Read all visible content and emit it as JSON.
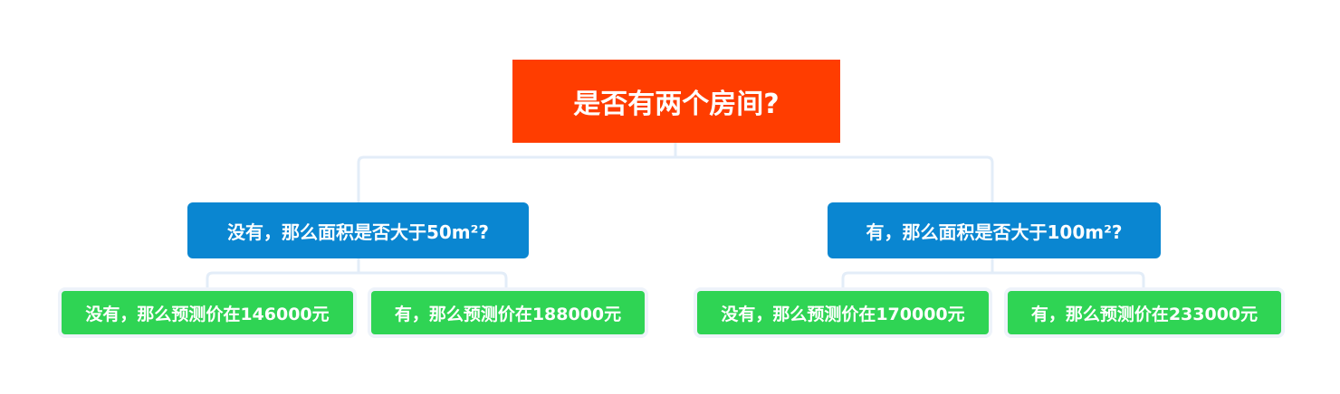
{
  "root": {
    "label": "是否有两个房间?"
  },
  "branches": [
    {
      "label": "没有，那么面积是否大于50m²?",
      "leaves": [
        {
          "label": "没有，那么预测价在146000元"
        },
        {
          "label": "有，那么预测价在188000元"
        }
      ]
    },
    {
      "label": "有，那么面积是否大于100m²?",
      "leaves": [
        {
          "label": "没有，那么预测价在170000元"
        },
        {
          "label": "有，那么预测价在233000元"
        }
      ]
    }
  ],
  "colors": {
    "root": "#ff3d00",
    "branch": "#0a86d1",
    "leaf": "#2fd454",
    "connector": "#e3edf8"
  }
}
